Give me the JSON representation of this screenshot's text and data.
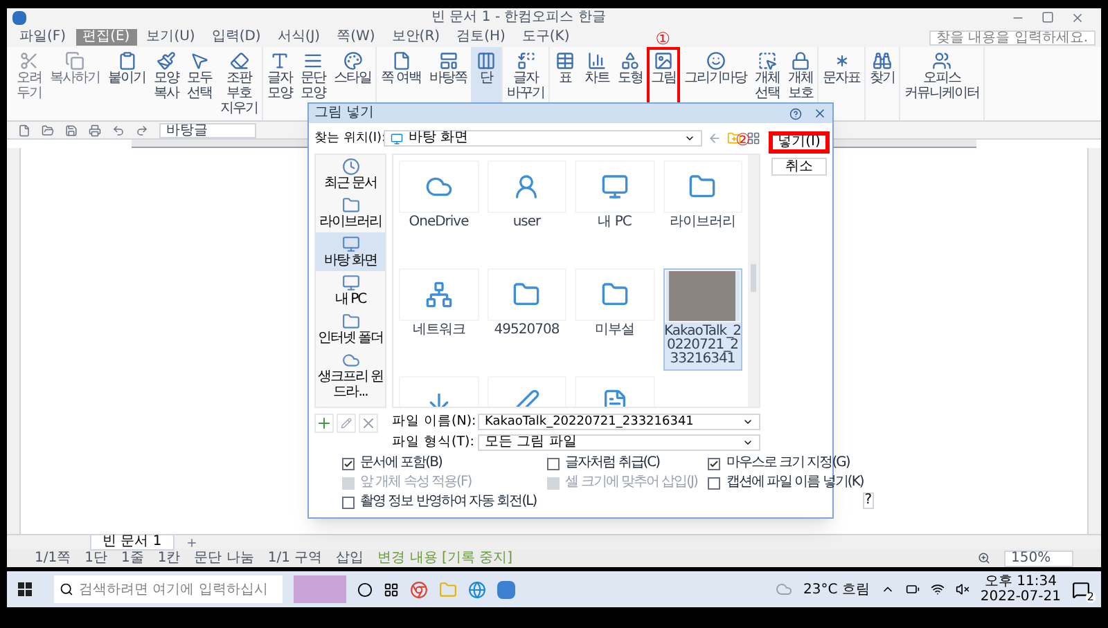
{
  "window": {
    "title": "빈 문서 1 - 한컴오피스 한글"
  },
  "menu": [
    {
      "label": "파일(F)",
      "selected": false
    },
    {
      "label": "편집(E)",
      "selected": true
    },
    {
      "label": "보기(U)",
      "selected": false
    },
    {
      "label": "입력(D)",
      "selected": false
    },
    {
      "label": "서식(J)",
      "selected": false
    },
    {
      "label": "쪽(W)",
      "selected": false
    },
    {
      "label": "보안(R)",
      "selected": false
    },
    {
      "label": "검토(H)",
      "selected": false
    },
    {
      "label": "도구(K)",
      "selected": false
    }
  ],
  "help_search": {
    "placeholder": "찾을 내용을 입력하세요."
  },
  "ribbon": [
    {
      "items": [
        {
          "label": "오려 두기",
          "disabled": true,
          "selected": false,
          "highlighted": false
        },
        {
          "label": "복사하기",
          "disabled": true,
          "selected": false,
          "highlighted": false
        },
        {
          "label": "붙이기",
          "disabled": false,
          "selected": false,
          "highlighted": false
        },
        {
          "label": "모양 복사",
          "disabled": false,
          "selected": false,
          "highlighted": false
        },
        {
          "label": "모두 선택",
          "disabled": false,
          "selected": false,
          "highlighted": false
        },
        {
          "label": "조판 부호 지우기",
          "disabled": false,
          "selected": false,
          "highlighted": false
        }
      ]
    },
    {
      "items": [
        {
          "label": "글자 모양",
          "disabled": false,
          "selected": false,
          "highlighted": false
        },
        {
          "label": "문단 모양",
          "disabled": false,
          "selected": false,
          "highlighted": false
        },
        {
          "label": "스타일",
          "disabled": false,
          "selected": false,
          "highlighted": false
        }
      ]
    },
    {
      "items": [
        {
          "label": "쪽 여백",
          "disabled": false,
          "selected": false,
          "highlighted": false
        },
        {
          "label": "바탕쪽",
          "disabled": false,
          "selected": false,
          "highlighted": false
        },
        {
          "label": "단",
          "disabled": false,
          "selected": true,
          "highlighted": false
        }
      ]
    },
    {
      "items": [
        {
          "label": "글자 바꾸기",
          "disabled": false,
          "selected": false,
          "highlighted": false
        }
      ]
    },
    {
      "items": [
        {
          "label": "표",
          "disabled": false,
          "selected": false,
          "highlighted": false
        },
        {
          "label": "차트",
          "disabled": false,
          "selected": false,
          "highlighted": false
        },
        {
          "label": "도형",
          "disabled": false,
          "selected": false,
          "highlighted": false
        },
        {
          "label": "그림",
          "disabled": false,
          "selected": false,
          "highlighted": true,
          "annotation": "①"
        },
        {
          "label": "그리기마당",
          "disabled": false,
          "selected": false,
          "highlighted": false
        },
        {
          "label": "개체 선택",
          "disabled": false,
          "selected": false,
          "highlighted": false
        },
        {
          "label": "개체 보호",
          "disabled": false,
          "selected": false,
          "highlighted": false
        }
      ]
    },
    {
      "items": [
        {
          "label": "문자표",
          "disabled": false,
          "selected": false,
          "highlighted": false
        }
      ]
    },
    {
      "items": [
        {
          "label": "찾기",
          "disabled": false,
          "selected": false,
          "highlighted": false
        }
      ]
    },
    {
      "items": [
        {
          "label": "오피스 커뮤니케이터",
          "disabled": false,
          "selected": false,
          "highlighted": false
        }
      ]
    }
  ],
  "toolbar": {
    "style": "바탕글"
  },
  "dialog": {
    "title": "그림 넣기",
    "location_label": "찾는 위치(I):",
    "location": "바탕 화면",
    "places": [
      {
        "label": "최근 문서",
        "selected": false
      },
      {
        "label": "라이브러리",
        "selected": false
      },
      {
        "label": "바탕 화면",
        "selected": true
      },
      {
        "label": "내 PC",
        "selected": false
      },
      {
        "label": "인터넷 폴더",
        "selected": false
      },
      {
        "label": "생크프리 윈드라...",
        "selected": false
      }
    ],
    "files": [
      {
        "kind": "cloud",
        "name": "OneDrive",
        "selected": false
      },
      {
        "kind": "user",
        "name": "user",
        "selected": false
      },
      {
        "kind": "pc",
        "name": "내 PC",
        "selected": false
      },
      {
        "kind": "library",
        "name": "라이브러리",
        "selected": false
      },
      {
        "kind": "network",
        "name": "네트워크",
        "selected": false
      },
      {
        "kind": "folder",
        "name": "49520708",
        "selected": false
      },
      {
        "kind": "folder",
        "name": "미부설",
        "selected": false
      },
      {
        "kind": "photo",
        "name": "KakaoTalk_20220721_233216341",
        "selected": true
      },
      {
        "kind": "shortcut",
        "selected": false
      },
      {
        "kind": "signature",
        "selected": false
      },
      {
        "kind": "document",
        "selected": false
      }
    ],
    "file_name_label": "파일 이름(N):",
    "file_name": "KakaoTalk_20220721_233216341",
    "file_type_label": "파일 형식(T):",
    "file_type": "모든 그림 파일",
    "options": [
      {
        "label": "문서에 포함(B)",
        "checked": true,
        "disabled": false
      },
      {
        "label": "글자처럼 취급(C)",
        "checked": false,
        "disabled": false
      },
      {
        "label": "마우스로 크기 지정(G)",
        "checked": true,
        "disabled": false
      },
      {
        "label": "앞 개체 속성 적용(F)",
        "checked": false,
        "disabled": true
      },
      {
        "label": "셀 크기에 맞추어 삽입(J)",
        "checked": false,
        "disabled": true
      },
      {
        "label": "캡션에 파일 이름 넣기(K)",
        "checked": false,
        "disabled": false
      },
      {
        "label": "촬영 정보 반영하여 자동 회전(L)",
        "checked": false,
        "disabled": false
      }
    ],
    "insert_button": "넣기(I)",
    "insert_annotation": "②",
    "cancel_button": "취소",
    "help": "?"
  },
  "document_tab": "빈 문서 1",
  "status_bar": [
    "1/1쪽",
    "1단",
    "1줄",
    "1칸",
    "문단 나눔",
    "1/1 구역",
    "삽입",
    "변경 내용 [기록 중지]"
  ],
  "zoom": "150%",
  "taskbar": {
    "search_placeholder": "검색하려면 여기에 입력하십시",
    "weather": "23°C 흐림",
    "time": "오후 11:34",
    "date": "2022-07-21",
    "notifications": "2"
  }
}
